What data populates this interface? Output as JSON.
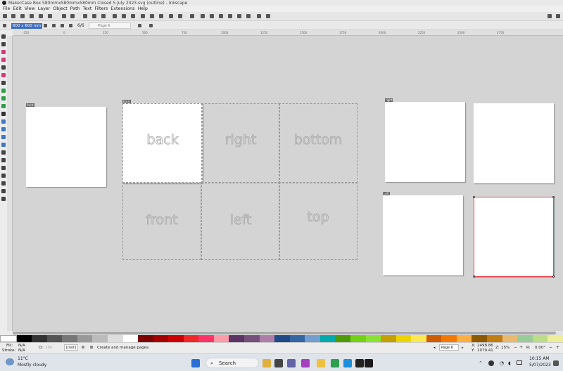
{
  "window": {
    "title": "MakerCase Box 580mmx580mmx580mm Closed 5 July 2023.svg (outline) - Inkscape"
  },
  "menu": [
    "File",
    "Edit",
    "View",
    "Layer",
    "Object",
    "Path",
    "Text",
    "Filters",
    "Extensions",
    "Help"
  ],
  "tool_controls": {
    "page_size": "600 x 600 mm",
    "page_counter": "6/6",
    "page_label_placeholder": "Page 6"
  },
  "ruler_ticks": [
    "-250",
    "0",
    "250",
    "500",
    "750",
    "1000",
    "1250",
    "1500",
    "1750",
    "2000",
    "2250",
    "2500",
    "2750"
  ],
  "pages": {
    "front_label": "front",
    "back_label": "back",
    "right_label": "right",
    "left_label": "Left"
  },
  "faces": [
    "back",
    "right",
    "bottom",
    "front",
    "left",
    "top"
  ],
  "status": {
    "fill_label": "Fill:",
    "fill_value": "N/A",
    "stroke_label": "Stroke:",
    "stroke_value": "N/A",
    "opacity_label": "O:",
    "opacity_value": "100",
    "layer": "[root]",
    "message": "Create and manage pages.",
    "page_select": "Page 6",
    "x_label": "X:",
    "x_value": "2498.86",
    "y_label": "Y:",
    "y_value": "1079.41",
    "zoom_label": "Z:",
    "zoom_value": "15%",
    "rot_label": "R:",
    "rot_value": "0.00°"
  },
  "taskbar": {
    "weather_temp": "11°C",
    "weather_desc": "Mostly cloudy",
    "search_label": "Search",
    "time": "10:15 AM",
    "date": "5/07/2023"
  },
  "colors": {
    "accent": "#3d6ebf",
    "canvas": "#d4d4d4",
    "selection": "#e8454f"
  }
}
